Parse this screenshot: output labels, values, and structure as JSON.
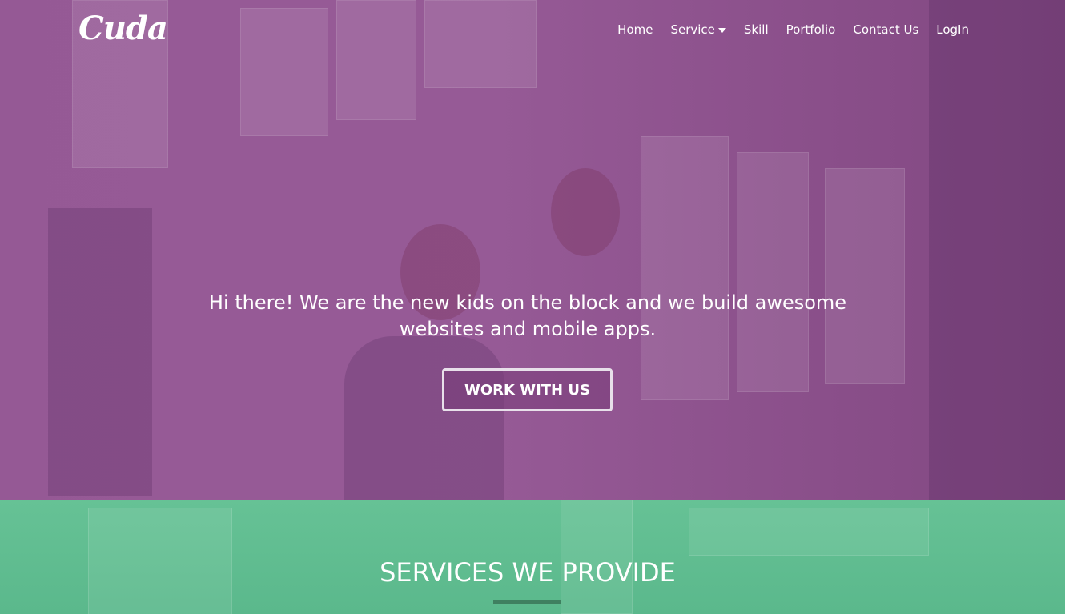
{
  "brand": {
    "logo": "Cuda"
  },
  "nav": {
    "items": [
      {
        "label": "Home"
      },
      {
        "label": "Service",
        "dropdown": true
      },
      {
        "label": "Skill"
      },
      {
        "label": "Portfolio"
      },
      {
        "label": "Contact Us"
      },
      {
        "label": "LogIn"
      }
    ]
  },
  "hero": {
    "headline_line1": "Hi there! We are the new kids on the block and we build awesome",
    "headline_line2": "websites and mobile apps.",
    "cta_label": "WORK WITH US",
    "overlay_color": "#9a5a9a"
  },
  "services": {
    "title": "SERVICES WE PROVIDE",
    "overlay_color": "#62c493",
    "underline_color": "#3f8060"
  }
}
